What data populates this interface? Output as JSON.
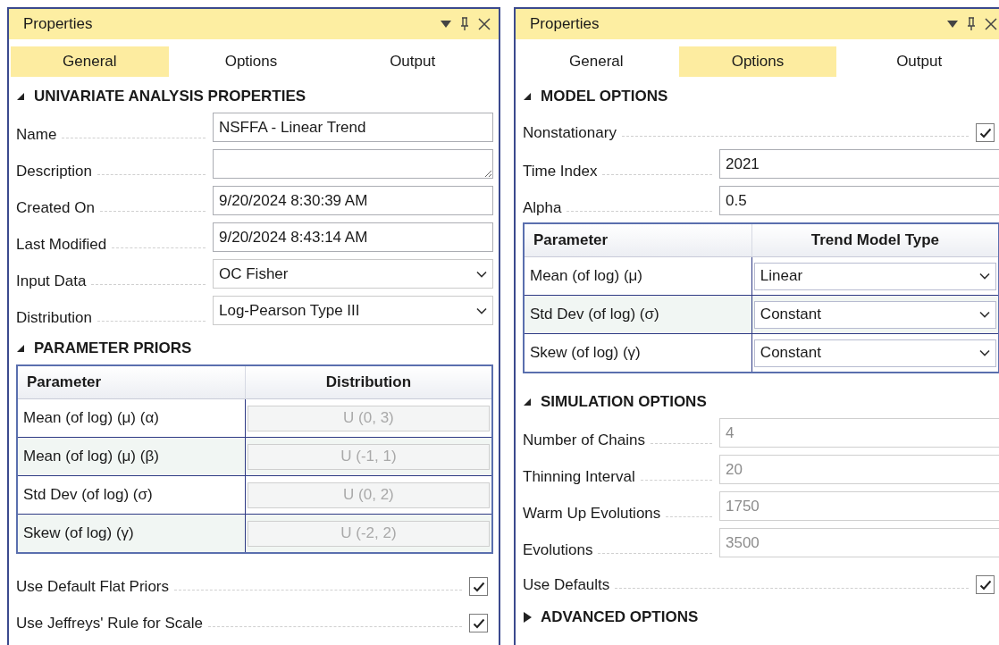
{
  "panels": [
    {
      "title": "Properties",
      "tabs": [
        {
          "label": "General",
          "selected": true
        },
        {
          "label": "Options",
          "selected": false
        },
        {
          "label": "Output",
          "selected": false
        }
      ],
      "sections": [
        {
          "title": "UNIVARIATE ANALYSIS PROPERTIES",
          "expanded": true,
          "rows": [
            {
              "kind": "text",
              "label": "Name",
              "value": "NSFFA - Linear Trend",
              "disabled": false
            },
            {
              "kind": "textarea",
              "label": "Description"
            },
            {
              "kind": "text",
              "label": "Created On",
              "value": "9/20/2024 8:30:39 AM",
              "disabled": false
            },
            {
              "kind": "text",
              "label": "Last Modified",
              "value": "9/20/2024 8:43:14 AM",
              "disabled": false
            },
            {
              "kind": "combo",
              "label": "Input Data",
              "value": "OC Fisher"
            },
            {
              "kind": "combo",
              "label": "Distribution",
              "value": "Log-Pearson Type III"
            }
          ]
        },
        {
          "title": "PARAMETER PRIORS",
          "expanded": true,
          "rows": [
            {
              "kind": "grid",
              "columns": [
                "Parameter",
                "Distribution"
              ],
              "rows": [
                {
                  "kind": "text",
                  "parameter": "Mean (of log) (μ) (α)",
                  "value": "U (0, 3)",
                  "disabled": true
                },
                {
                  "kind": "text",
                  "parameter": "Mean (of log) (μ) (β)",
                  "value": "U (-1, 1)",
                  "disabled": true
                },
                {
                  "kind": "text",
                  "parameter": "Std Dev (of log) (σ)",
                  "value": "U (0, 2)",
                  "disabled": true
                },
                {
                  "kind": "text",
                  "parameter": "Skew (of log) (γ)",
                  "value": "U (-2, 2)",
                  "disabled": true
                }
              ]
            },
            {
              "kind": "check",
              "label": "Use Default Flat Priors",
              "checked": true
            },
            {
              "kind": "check",
              "label": "Use Jeffreys' Rule for Scale",
              "checked": true
            }
          ]
        }
      ]
    },
    {
      "title": "Properties",
      "tabs": [
        {
          "label": "General",
          "selected": false
        },
        {
          "label": "Options",
          "selected": true
        },
        {
          "label": "Output",
          "selected": false
        }
      ],
      "sections": [
        {
          "title": "MODEL OPTIONS",
          "expanded": true,
          "rows": [
            {
              "kind": "check",
              "label": "Nonstationary",
              "checked": true
            },
            {
              "kind": "text",
              "label": "Time Index",
              "value": "2021",
              "disabled": false
            },
            {
              "kind": "text",
              "label": "Alpha",
              "value": "0.5",
              "disabled": false
            },
            {
              "kind": "grid",
              "columns": [
                "Parameter",
                "Trend Model Type"
              ],
              "rows": [
                {
                  "kind": "combo",
                  "parameter": "Mean (of log) (μ)",
                  "value": "Linear"
                },
                {
                  "kind": "combo",
                  "parameter": "Std Dev (of log) (σ)",
                  "value": "Constant"
                },
                {
                  "kind": "combo",
                  "parameter": "Skew (of log) (γ)",
                  "value": "Constant"
                }
              ]
            }
          ]
        },
        {
          "title": "SIMULATION OPTIONS",
          "expanded": true,
          "rows": [
            {
              "kind": "text",
              "label": "Number of Chains",
              "value": "4",
              "disabled": true
            },
            {
              "kind": "text",
              "label": "Thinning Interval",
              "value": "20",
              "disabled": true
            },
            {
              "kind": "text",
              "label": "Warm Up Evolutions",
              "value": "1750",
              "disabled": true
            },
            {
              "kind": "text",
              "label": "Evolutions",
              "value": "3500",
              "disabled": true
            },
            {
              "kind": "check",
              "label": "Use Defaults",
              "checked": true
            }
          ]
        },
        {
          "title": "ADVANCED OPTIONS",
          "expanded": false
        }
      ]
    }
  ]
}
